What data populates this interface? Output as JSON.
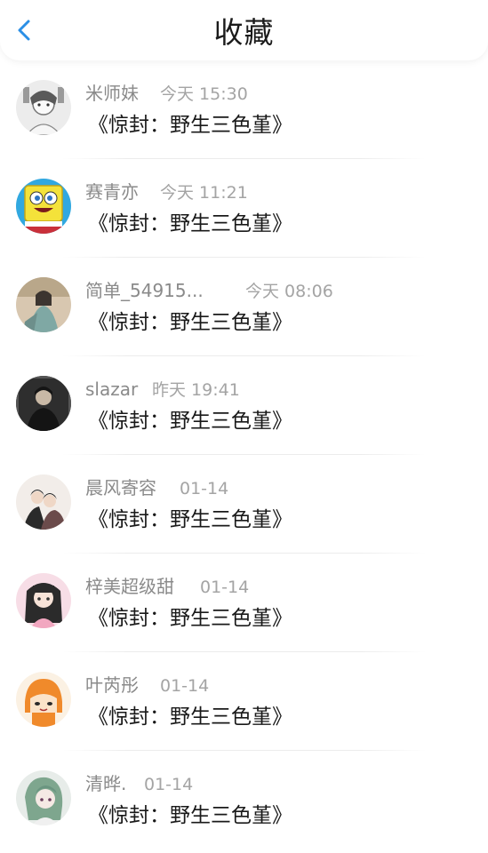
{
  "header": {
    "back_icon": "chevron-left-icon",
    "title": "收藏"
  },
  "colors": {
    "accent": "#2b8fe6",
    "title": "#1b1b1b",
    "username": "#8a8a8a",
    "time": "#a4a4a4",
    "content": "#191919",
    "divider": "#ececec"
  },
  "items": [
    {
      "username": "米师妹",
      "time": "今天 15:30",
      "content": "《惊封：野生三色堇》"
    },
    {
      "username": "赛青亦",
      "time": "今天 11:21",
      "content": "《惊封：野生三色堇》"
    },
    {
      "username": "简单_54915...",
      "time": "今天 08:06",
      "content": "《惊封：野生三色堇》"
    },
    {
      "username": "slazar",
      "time": "昨天 19:41",
      "content": "《惊封：野生三色堇》"
    },
    {
      "username": "晨风寄容",
      "time": "01-14",
      "content": "《惊封：野生三色堇》"
    },
    {
      "username": "梓美超级甜",
      "time": "01-14",
      "content": "《惊封：野生三色堇》"
    },
    {
      "username": "叶芮彤",
      "time": "01-14",
      "content": "《惊封：野生三色堇》"
    },
    {
      "username": "清晔.",
      "time": "01-14",
      "content": "《惊封：野生三色堇》"
    }
  ]
}
